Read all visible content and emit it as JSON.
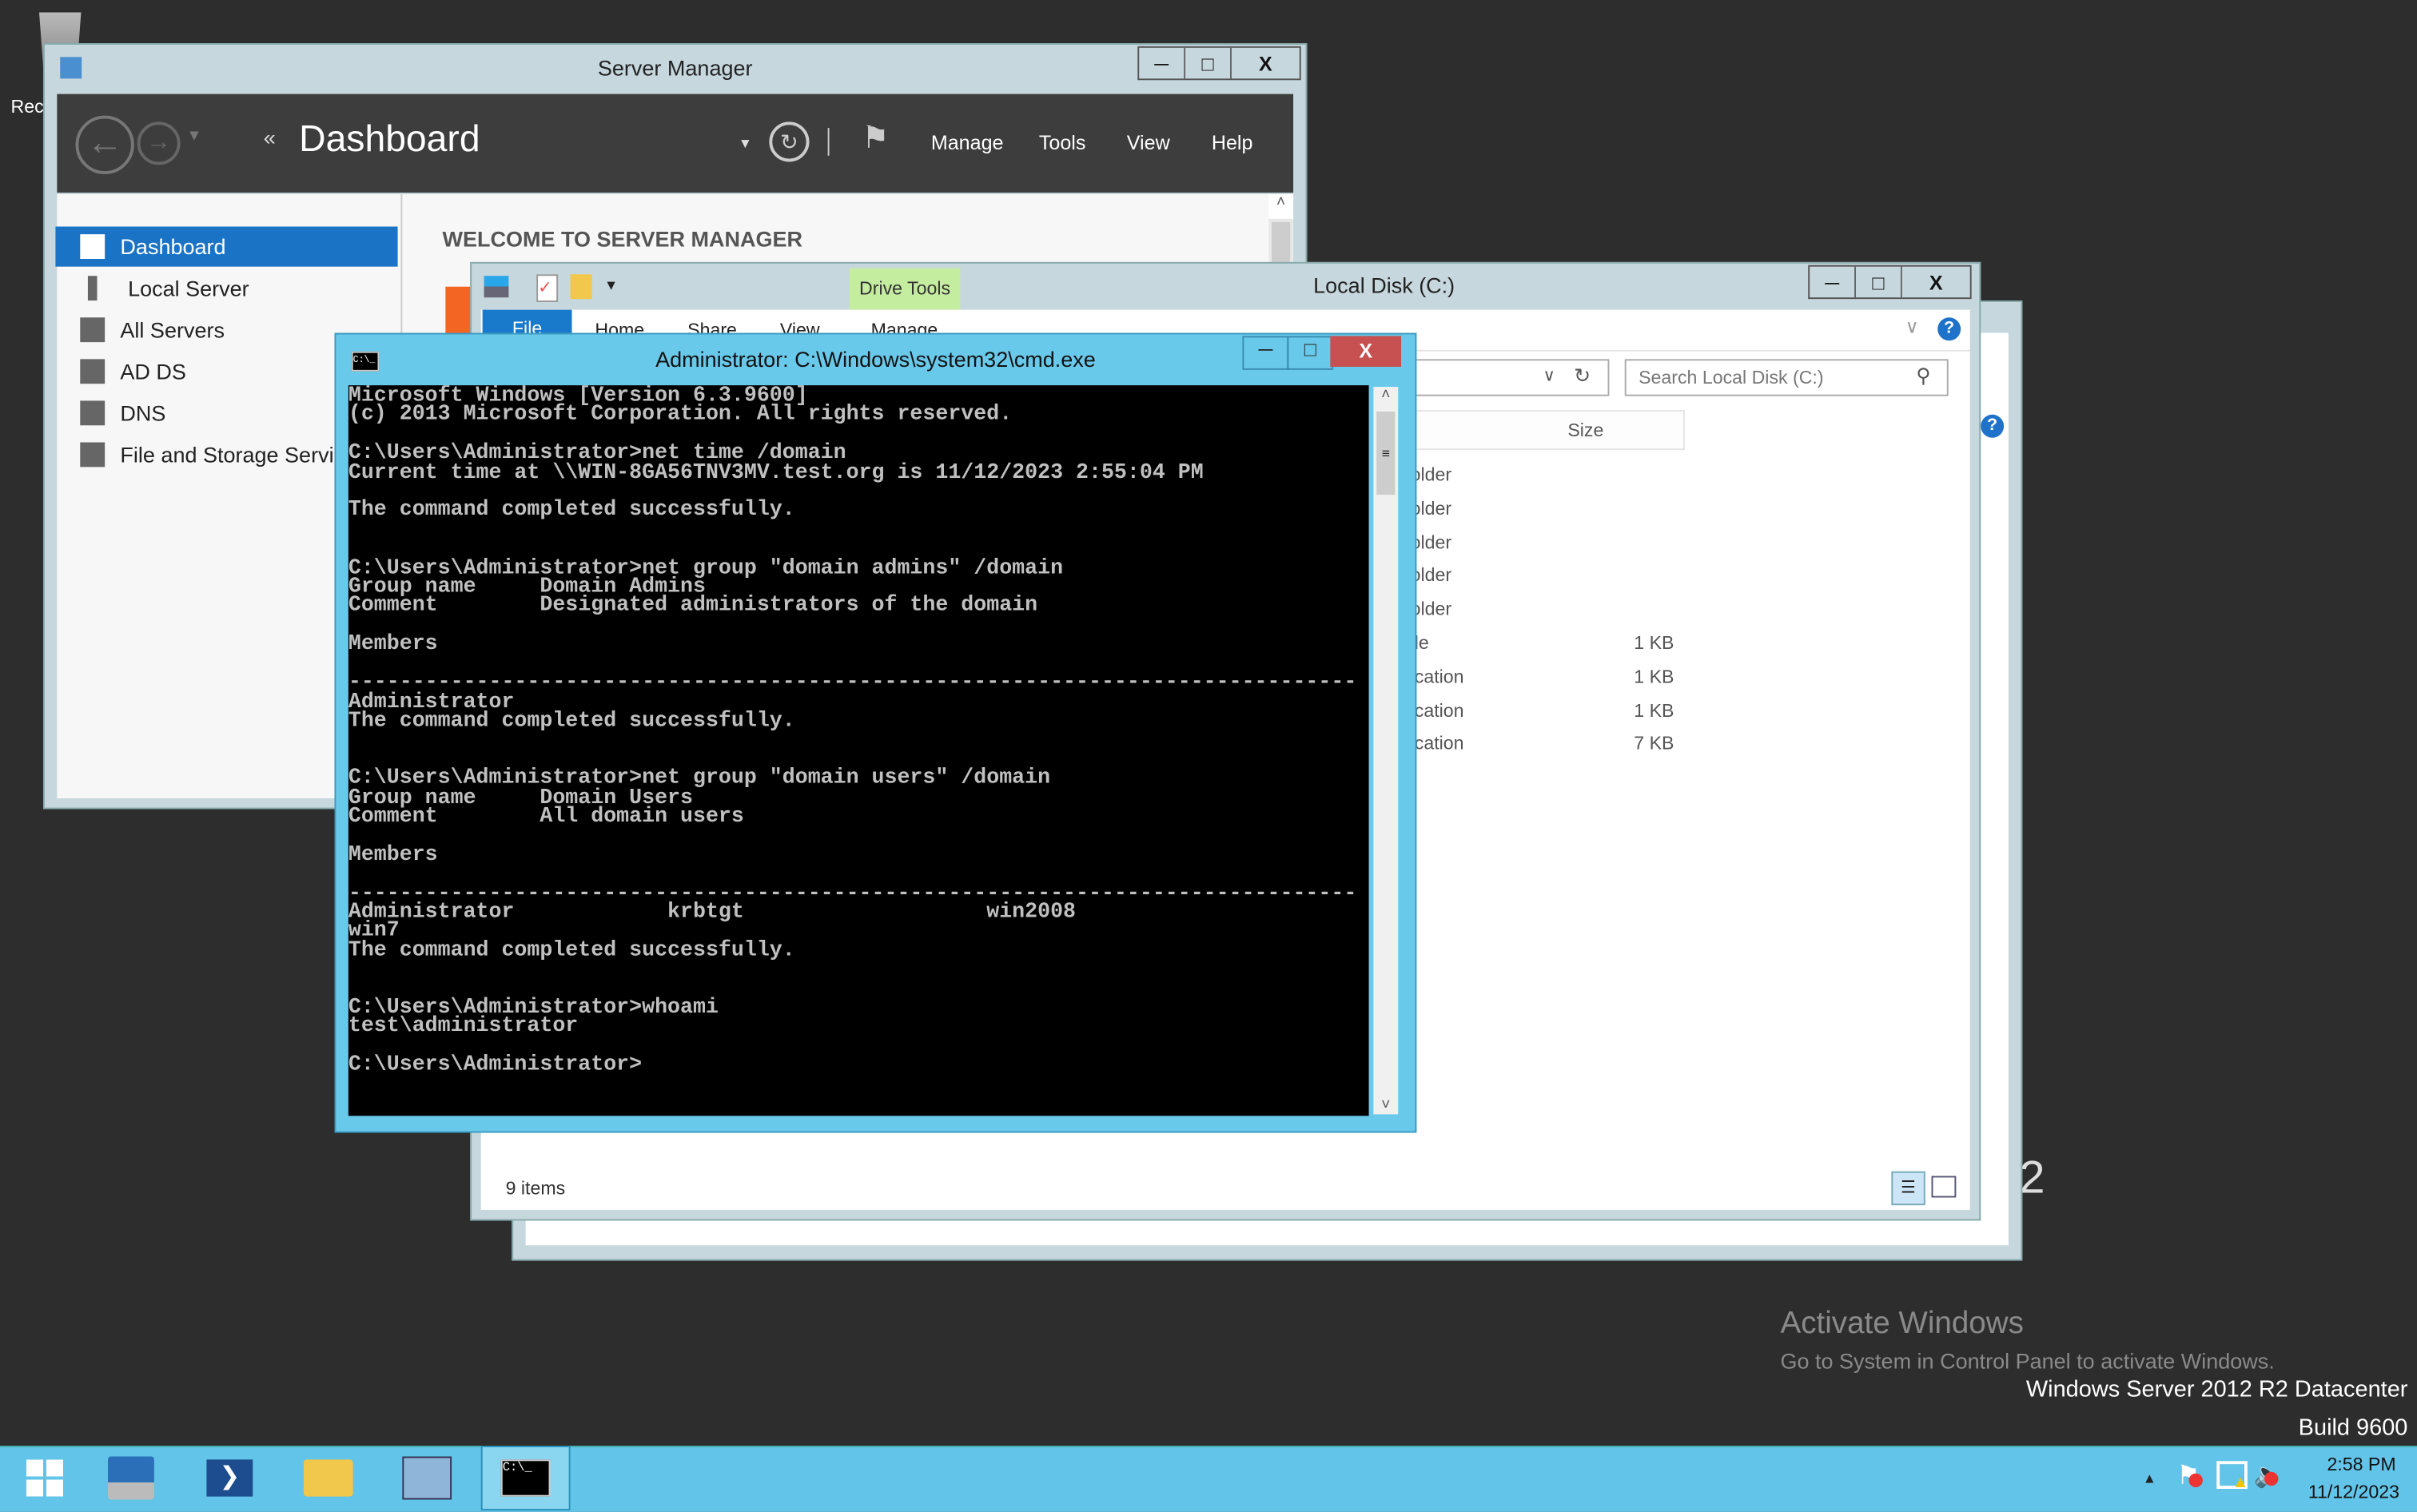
{
  "desktop": {
    "recycle_bin_label": "Rec",
    "watermark_title": "Activate Windows",
    "watermark_text": "Go to System in Control Panel to activate Windows.",
    "edition": "Windows Server 2012 R2 Datacenter",
    "build": "Build 9600",
    "partial_text": "2"
  },
  "server_manager": {
    "title": "Server Manager",
    "header_title": "Dashboard",
    "menu": [
      "Manage",
      "Tools",
      "View",
      "Help"
    ],
    "sidebar": [
      {
        "label": "Dashboard",
        "selected": true
      },
      {
        "label": "Local Server"
      },
      {
        "label": "All Servers"
      },
      {
        "label": "AD DS"
      },
      {
        "label": "DNS"
      },
      {
        "label": "File and Storage Servi"
      }
    ],
    "welcome": "WELCOME TO SERVER MANAGER"
  },
  "explorer": {
    "title": "Local Disk (C:)",
    "context_tab": "Drive Tools",
    "tabs": [
      "File",
      "Home",
      "Share",
      "View",
      "Manage"
    ],
    "search_placeholder": "Search Local Disk (C:)",
    "column_size": "Size",
    "rows": [
      {
        "type": "older",
        "size": ""
      },
      {
        "type": "older",
        "size": ""
      },
      {
        "type": "older",
        "size": ""
      },
      {
        "type": "older",
        "size": ""
      },
      {
        "type": "older",
        "size": ""
      },
      {
        "type": "ile",
        "size": "1 KB"
      },
      {
        "type": "ication",
        "size": "1 KB"
      },
      {
        "type": "ication",
        "size": "1 KB"
      },
      {
        "type": "ication",
        "size": "7 KB"
      }
    ],
    "status": "9 items"
  },
  "cmd": {
    "title": "Administrator: C:\\Windows\\system32\\cmd.exe",
    "icon_text": "C:\\_",
    "output": "Microsoft Windows [Version 6.3.9600]\n(c) 2013 Microsoft Corporation. All rights reserved.\n\nC:\\Users\\Administrator>net time /domain\nCurrent time at \\\\WIN-8GA56TNV3MV.test.org is 11/12/2023 2:55:04 PM\n\nThe command completed successfully.\n\n\nC:\\Users\\Administrator>net group \"domain admins\" /domain\nGroup name     Domain Admins\nComment        Designated administrators of the domain\n\nMembers\n\n-------------------------------------------------------------------------------\nAdministrator\nThe command completed successfully.\n\n\nC:\\Users\\Administrator>net group \"domain users\" /domain\nGroup name     Domain Users\nComment        All domain users\n\nMembers\n\n-------------------------------------------------------------------------------\nAdministrator            krbtgt                   win2008\nwin7\nThe command completed successfully.\n\n\nC:\\Users\\Administrator>whoami\ntest\\administrator\n\nC:\\Users\\Administrator>"
  },
  "taskbar": {
    "apps": [
      "start",
      "server-manager",
      "powershell",
      "file-explorer",
      "control-panel",
      "cmd"
    ],
    "active": "cmd",
    "time": "2:58 PM",
    "date": "11/12/2023"
  },
  "colors": {
    "cmd_titlebar": "#69c9ea",
    "close_red": "#c75050",
    "selection_blue": "#1a73c4",
    "taskbar": "#62c4e8",
    "drive_tools": "#c5eda0"
  }
}
